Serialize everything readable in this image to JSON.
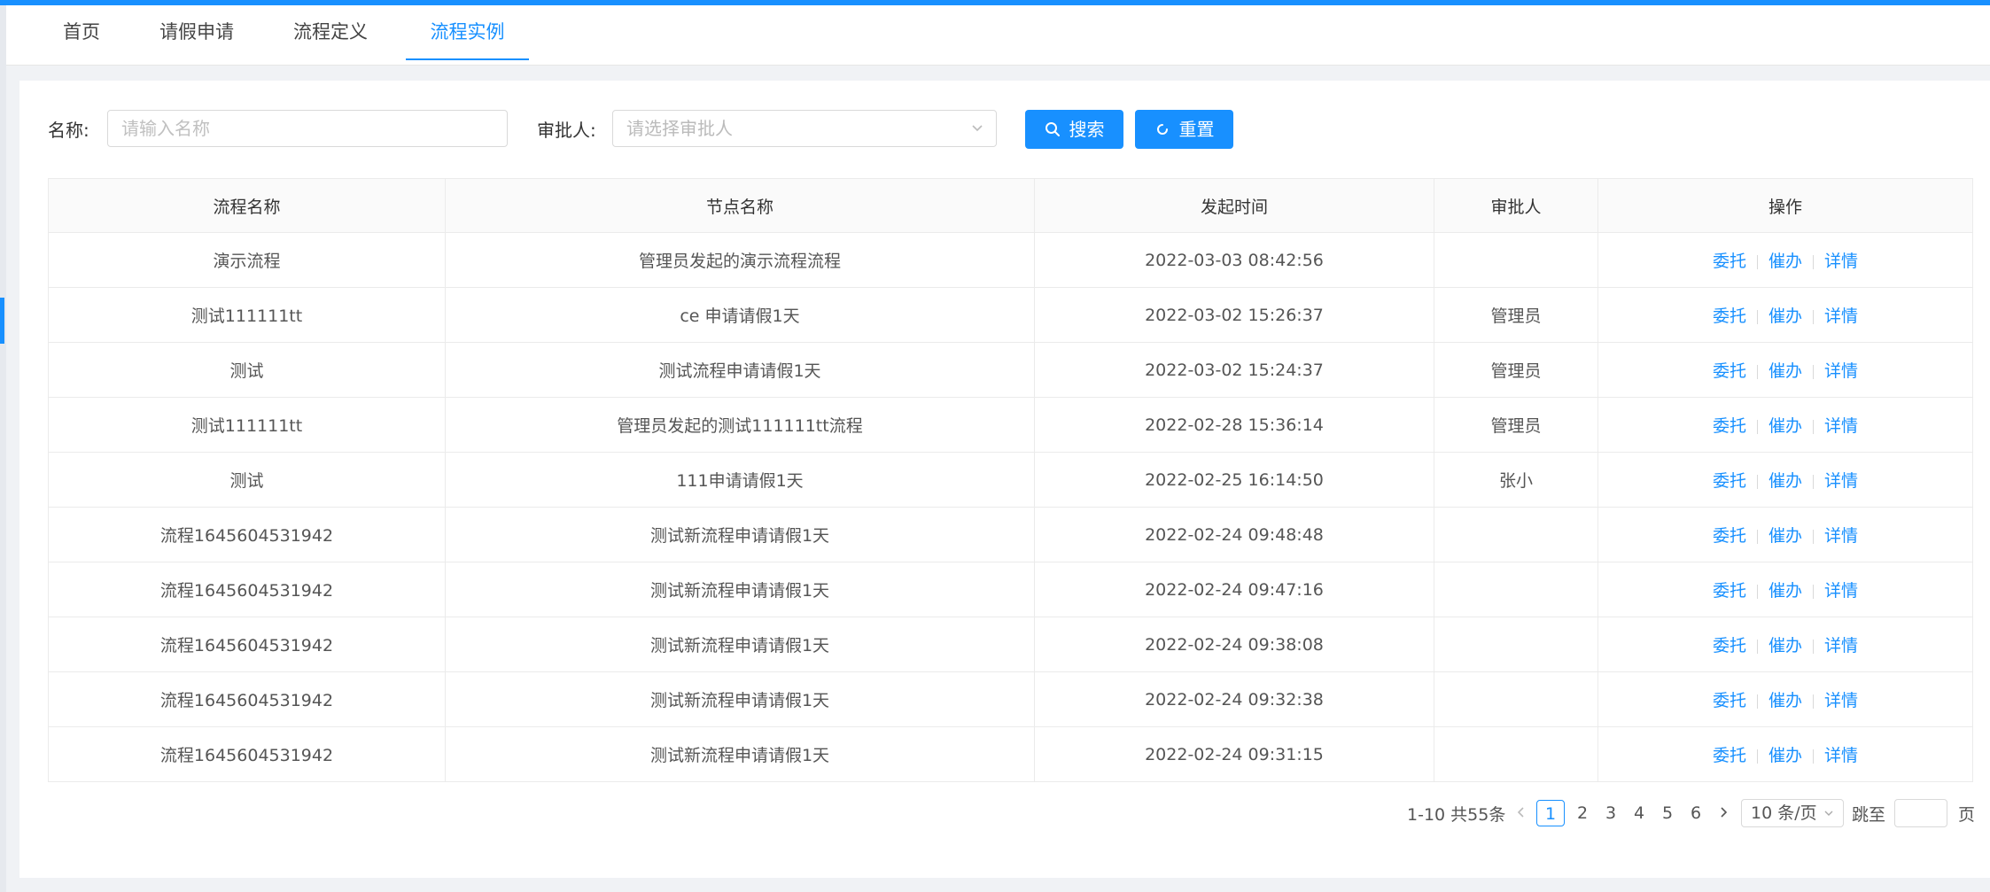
{
  "tabs": [
    {
      "label": "首页"
    },
    {
      "label": "请假申请"
    },
    {
      "label": "流程定义"
    },
    {
      "label": "流程实例"
    }
  ],
  "filters": {
    "name_label": "名称:",
    "name_placeholder": "请输入名称",
    "approver_label": "审批人:",
    "approver_placeholder": "请选择审批人",
    "search_label": "搜索",
    "reset_label": "重置"
  },
  "table": {
    "columns": [
      "流程名称",
      "节点名称",
      "发起时间",
      "审批人",
      "操作"
    ],
    "rows": [
      {
        "process": "演示流程",
        "node": "管理员发起的演示流程流程",
        "time": "2022-03-03 08:42:56",
        "approver": ""
      },
      {
        "process": "测试111111tt",
        "node": "ce 申请请假1天",
        "time": "2022-03-02 15:26:37",
        "approver": "管理员"
      },
      {
        "process": "测试",
        "node": "测试流程申请请假1天",
        "time": "2022-03-02 15:24:37",
        "approver": "管理员"
      },
      {
        "process": "测试111111tt",
        "node": "管理员发起的测试111111tt流程",
        "time": "2022-02-28 15:36:14",
        "approver": "管理员"
      },
      {
        "process": "测试",
        "node": "111申请请假1天",
        "time": "2022-02-25 16:14:50",
        "approver": "张小"
      },
      {
        "process": "流程1645604531942",
        "node": "测试新流程申请请假1天",
        "time": "2022-02-24 09:48:48",
        "approver": ""
      },
      {
        "process": "流程1645604531942",
        "node": "测试新流程申请请假1天",
        "time": "2022-02-24 09:47:16",
        "approver": ""
      },
      {
        "process": "流程1645604531942",
        "node": "测试新流程申请请假1天",
        "time": "2022-02-24 09:38:08",
        "approver": ""
      },
      {
        "process": "流程1645604531942",
        "node": "测试新流程申请请假1天",
        "time": "2022-02-24 09:32:38",
        "approver": ""
      },
      {
        "process": "流程1645604531942",
        "node": "测试新流程申请请假1天",
        "time": "2022-02-24 09:31:15",
        "approver": ""
      }
    ],
    "actions": {
      "delegate": "委托",
      "urge": "催办",
      "detail": "详情"
    }
  },
  "pagination": {
    "total_text": "1-10 共55条",
    "pages": [
      "1",
      "2",
      "3",
      "4",
      "5",
      "6"
    ],
    "current": "1",
    "page_size": "10 条/页",
    "jump_label": "跳至",
    "page_suffix": "页"
  },
  "colors": {
    "accent": "#1890ff"
  }
}
